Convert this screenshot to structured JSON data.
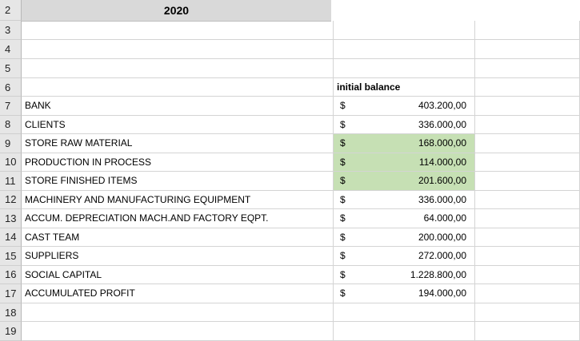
{
  "title": "2020",
  "row_numbers": [
    "2",
    "3",
    "4",
    "5",
    "6",
    "7",
    "8",
    "9",
    "10",
    "11",
    "12",
    "13",
    "14",
    "15",
    "16",
    "17",
    "18",
    "19"
  ],
  "column_header": "initial balance",
  "currency_symbol": "$",
  "highlight_color": "#c6e0b4",
  "rows": [
    {
      "label": "BANK",
      "amount": "403.200,00",
      "highlight": false
    },
    {
      "label": "CLIENTS",
      "amount": "336.000,00",
      "highlight": false
    },
    {
      "label": "STORE RAW MATERIAL",
      "amount": "168.000,00",
      "highlight": true
    },
    {
      "label": "PRODUCTION IN PROCESS",
      "amount": "114.000,00",
      "highlight": true
    },
    {
      "label": "STORE FINISHED ITEMS",
      "amount": "201.600,00",
      "highlight": true
    },
    {
      "label": "MACHINERY AND MANUFACTURING EQUIPMENT",
      "amount": "336.000,00",
      "highlight": false
    },
    {
      "label": "ACCUM. DEPRECIATION MACH.AND FACTORY EQPT.",
      "amount": "64.000,00",
      "highlight": false
    },
    {
      "label": "CAST TEAM",
      "amount": "200.000,00",
      "highlight": false
    },
    {
      "label": "SUPPLIERS",
      "amount": "272.000,00",
      "highlight": false
    },
    {
      "label": "SOCIAL CAPITAL",
      "amount": "1.228.800,00",
      "highlight": false
    },
    {
      "label": "ACCUMULATED PROFIT",
      "amount": "194.000,00",
      "highlight": false
    }
  ]
}
